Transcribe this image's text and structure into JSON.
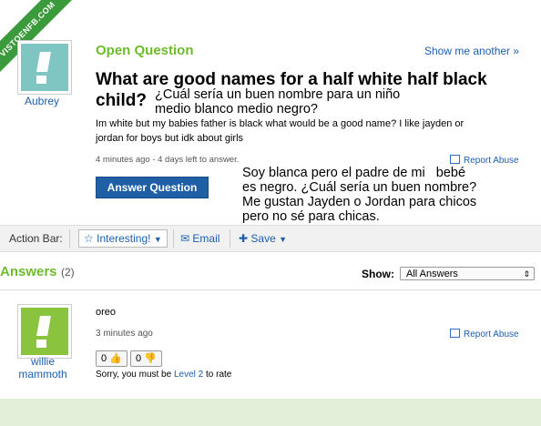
{
  "watermark": "VISTOENFB.COM",
  "question": {
    "status": "Open Question",
    "show_another": "Show me another »",
    "asker_name": "Aubrey",
    "title_line1": "What are good names for a half white half black",
    "title_line2": "child?",
    "translation_title": "¿Cuál sería un buen nombre para un niño\nmedio blanco medio negro?",
    "details_line1": "Im white but my babies father is black what would be a good name? I like jayden or",
    "details_line2": "jordan for boys but idk about girls",
    "meta": "4 minutes ago - 4 days left to answer.",
    "report_abuse": "Report Abuse",
    "answer_button": "Answer Question",
    "translation_details": "Soy blanca pero el padre de mi   bebé\nes negro. ¿Cuál sería un buen nombre?\nMe gustan Jayden o Jordan para chicos\npero no sé para chicas."
  },
  "action_bar": {
    "label": "Action Bar:",
    "interesting": "Interesting!",
    "email": "Email",
    "save": "Save"
  },
  "answers": {
    "heading": "Answers",
    "count": "(2)",
    "show_label": "Show:",
    "show_value": "All Answers",
    "items": [
      {
        "text": "oreo",
        "time": "3 minutes ago",
        "report_abuse": "Report Abuse",
        "author_line1": "willie",
        "author_line2": "mammoth",
        "thumbs_up": "0",
        "thumbs_down": "0",
        "rate_note_prefix": "Sorry, you must be ",
        "rate_note_link": "Level 2",
        "rate_note_suffix": " to rate"
      }
    ]
  },
  "colors": {
    "brand_green": "#6dbb2d",
    "link_blue": "#1b5faf",
    "button_blue": "#1f5fa6",
    "asker_avatar": "#7fc6c3",
    "answerer_avatar": "#8ac43f"
  }
}
